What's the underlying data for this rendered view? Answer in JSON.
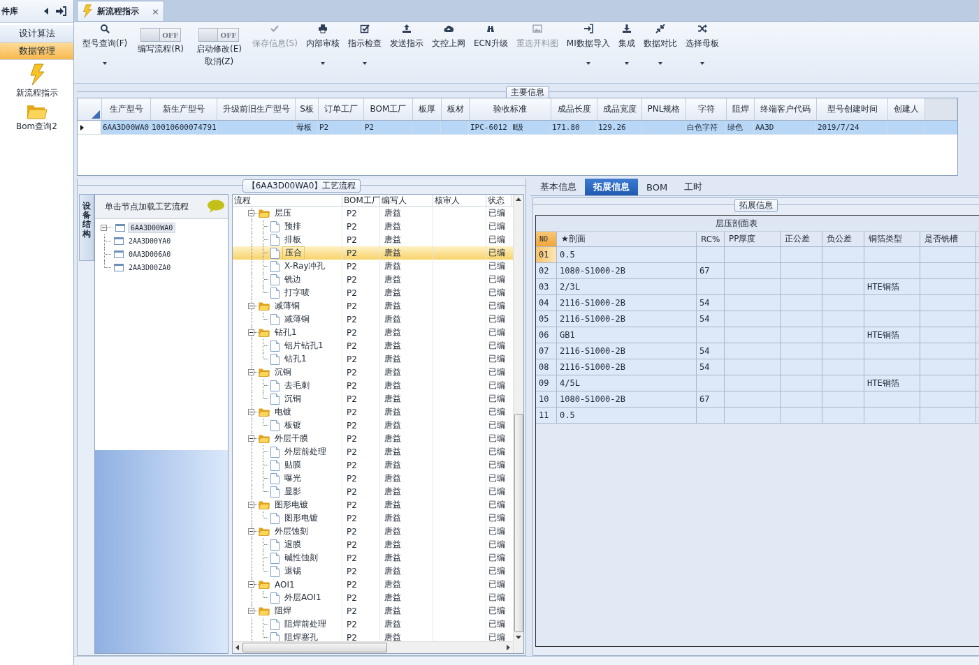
{
  "sidebar": {
    "title": "件库",
    "menu": [
      {
        "label": "设计算法",
        "selected": false
      },
      {
        "label": "数据管理",
        "selected": true
      }
    ],
    "launchers": [
      {
        "label": "新流程指示"
      },
      {
        "label": "Bom查询2"
      }
    ]
  },
  "document_tab": {
    "label": "新流程指示",
    "close": "×"
  },
  "toolbar": [
    {
      "kind": "button",
      "label": "型号查询(F)",
      "dropdown": true,
      "disabled": false
    },
    {
      "kind": "toggle",
      "label": "编写流程(R)",
      "state": "OFF",
      "on": false
    },
    {
      "kind": "toggle",
      "label": "启动修改(E)",
      "sublabel": "取消(Z)",
      "state": "OFF",
      "on": false
    },
    {
      "kind": "button",
      "label": "保存信息(S)",
      "dropdown": false,
      "disabled": true
    },
    {
      "kind": "button",
      "label": "内部审核",
      "dropdown": true,
      "disabled": false
    },
    {
      "kind": "button",
      "label": "指示检查",
      "dropdown": true,
      "disabled": false
    },
    {
      "kind": "button",
      "label": "发送指示",
      "dropdown": false,
      "disabled": false
    },
    {
      "kind": "button",
      "label": "文控上网",
      "dropdown": false,
      "disabled": false
    },
    {
      "kind": "button",
      "label": "ECN升级",
      "dropdown": false,
      "disabled": false
    },
    {
      "kind": "button",
      "label": "重选开料图",
      "dropdown": false,
      "disabled": true
    },
    {
      "kind": "button",
      "label": "MI数据导入",
      "dropdown": true,
      "disabled": false
    },
    {
      "kind": "button",
      "label": "集成",
      "dropdown": true,
      "disabled": false
    },
    {
      "kind": "button",
      "label": "数据对比",
      "dropdown": true,
      "disabled": false
    },
    {
      "kind": "button",
      "label": "选择母板",
      "dropdown": true,
      "disabled": false
    }
  ],
  "main_info": {
    "legend": "主要信息",
    "columns": [
      "生产型号",
      "新生产型号",
      "升级前旧生产型号",
      "S板",
      "订单工厂",
      "BOM工厂",
      "板厚",
      "板材",
      "验收标准",
      "成品长度",
      "成品宽度",
      "PNL规格",
      "字符",
      "阻焊",
      "终端客户代码",
      "型号创建时间",
      "创建人"
    ],
    "rows": [
      {
        "selected": true,
        "cells": [
          "6AA3D00WA0",
          "10010600074791",
          null,
          "母板",
          "P2",
          "P2",
          null,
          null,
          "IPC-6012 Ⅱ级",
          "171.80",
          "129.26",
          null,
          "白色字符",
          "绿色",
          "AA3D",
          "2019/7/24",
          null
        ]
      }
    ]
  },
  "process": {
    "legend": "【6AA3D00WA0】工艺流程",
    "side_tab": "设备结构",
    "hint": "单击节点加载工艺流程",
    "tree": {
      "label": "6AA3D00WA0",
      "expanded": true,
      "selected": true,
      "children": [
        {
          "label": "2AA3D00YA0",
          "selected": false
        },
        {
          "label": "0AA3D006A0",
          "selected": false
        },
        {
          "label": "2AA3D00ZA0",
          "selected": false
        }
      ]
    },
    "columns": [
      "流程",
      "BOM工厂",
      "编写人",
      "核审人",
      "状态"
    ],
    "steps": [
      {
        "name": "层压",
        "bom": "P2",
        "author": "唐益",
        "status": "已编",
        "expanded": true,
        "selected": false,
        "children": [
          {
            "name": "预排",
            "bom": "P2",
            "author": "唐益",
            "status": "已编",
            "selected": false
          },
          {
            "name": "排板",
            "bom": "P2",
            "author": "唐益",
            "status": "已编",
            "selected": false
          },
          {
            "name": "压合",
            "bom": "P2",
            "author": "唐益",
            "status": "已编",
            "selected": true
          },
          {
            "name": "X-Ray冲孔",
            "bom": "P2",
            "author": "唐益",
            "status": "已编",
            "selected": false
          },
          {
            "name": "铣边",
            "bom": "P2",
            "author": "唐益",
            "status": "已编",
            "selected": false
          },
          {
            "name": "打字唛",
            "bom": "P2",
            "author": "唐益",
            "status": "已编",
            "selected": false
          }
        ]
      },
      {
        "name": "减薄铜",
        "bom": "P2",
        "author": "唐益",
        "status": "已编",
        "expanded": true,
        "selected": false,
        "children": [
          {
            "name": "减薄铜",
            "bom": "P2",
            "author": "唐益",
            "status": "已编",
            "selected": false
          }
        ]
      },
      {
        "name": "钻孔1",
        "bom": "P2",
        "author": "唐益",
        "status": "已编",
        "expanded": true,
        "selected": false,
        "children": [
          {
            "name": "铝片钻孔1",
            "bom": "P2",
            "author": "唐益",
            "status": "已编",
            "selected": false
          },
          {
            "name": "钻孔1",
            "bom": "P2",
            "author": "唐益",
            "status": "已编",
            "selected": false
          }
        ]
      },
      {
        "name": "沉铜",
        "bom": "P2",
        "author": "唐益",
        "status": "已编",
        "expanded": true,
        "selected": false,
        "children": [
          {
            "name": "去毛刺",
            "bom": "P2",
            "author": "唐益",
            "status": "已编",
            "selected": false
          },
          {
            "name": "沉铜",
            "bom": "P2",
            "author": "唐益",
            "status": "已编",
            "selected": false
          }
        ]
      },
      {
        "name": "电镀",
        "bom": "P2",
        "author": "唐益",
        "status": "已编",
        "expanded": true,
        "selected": false,
        "children": [
          {
            "name": "板镀",
            "bom": "P2",
            "author": "唐益",
            "status": "已编",
            "selected": false
          }
        ]
      },
      {
        "name": "外层干膜",
        "bom": "P2",
        "author": "唐益",
        "status": "已编",
        "expanded": true,
        "selected": false,
        "children": [
          {
            "name": "外层前处理",
            "bom": "P2",
            "author": "唐益",
            "status": "已编",
            "selected": false
          },
          {
            "name": "贴膜",
            "bom": "P2",
            "author": "唐益",
            "status": "已编",
            "selected": false
          },
          {
            "name": "曝光",
            "bom": "P2",
            "author": "唐益",
            "status": "已编",
            "selected": false
          },
          {
            "name": "显影",
            "bom": "P2",
            "author": "唐益",
            "status": "已编",
            "selected": false
          }
        ]
      },
      {
        "name": "图形电镀",
        "bom": "P2",
        "author": "唐益",
        "status": "已编",
        "expanded": true,
        "selected": false,
        "children": [
          {
            "name": "图形电镀",
            "bom": "P2",
            "author": "唐益",
            "status": "已编",
            "selected": false
          }
        ]
      },
      {
        "name": "外层蚀刻",
        "bom": "P2",
        "author": "唐益",
        "status": "已编",
        "expanded": true,
        "selected": false,
        "children": [
          {
            "name": "退膜",
            "bom": "P2",
            "author": "唐益",
            "status": "已编",
            "selected": false
          },
          {
            "name": "碱性蚀刻",
            "bom": "P2",
            "author": "唐益",
            "status": "已编",
            "selected": false
          },
          {
            "name": "退锡",
            "bom": "P2",
            "author": "唐益",
            "status": "已编",
            "selected": false
          }
        ]
      },
      {
        "name": "AOI1",
        "bom": "P2",
        "author": "唐益",
        "status": "已编",
        "expanded": true,
        "selected": false,
        "children": [
          {
            "name": "外层AOI1",
            "bom": "P2",
            "author": "唐益",
            "status": "已编",
            "selected": false
          }
        ]
      },
      {
        "name": "阻焊",
        "bom": "P2",
        "author": "唐益",
        "status": "已编",
        "expanded": true,
        "selected": false,
        "children": [
          {
            "name": "阻焊前处理",
            "bom": "P2",
            "author": "唐益",
            "status": "已编",
            "selected": false
          },
          {
            "name": "阻焊塞孔",
            "bom": "P2",
            "author": "唐益",
            "status": "已编",
            "selected": false
          }
        ]
      }
    ]
  },
  "detail": {
    "tabs": [
      {
        "label": "基本信息",
        "selected": false
      },
      {
        "label": "拓展信息",
        "selected": true
      },
      {
        "label": "BOM",
        "selected": false
      },
      {
        "label": "工时",
        "selected": false
      }
    ],
    "legend": "拓展信息",
    "table_title": "层压剖面表",
    "columns": [
      "NO",
      "★剖面",
      "RC%",
      "PP厚度",
      "正公差",
      "负公差",
      "铜箔类型",
      "是否铣槽"
    ],
    "rows": [
      {
        "selected": true,
        "cells": [
          "01",
          "0.5",
          null,
          null,
          null,
          null,
          null,
          null
        ]
      },
      {
        "selected": false,
        "cells": [
          "02",
          "1080-S1000-2B",
          "67",
          null,
          null,
          null,
          null,
          null
        ]
      },
      {
        "selected": false,
        "cells": [
          "03",
          "2/3L",
          null,
          null,
          null,
          null,
          "HTE铜箔",
          null
        ]
      },
      {
        "selected": false,
        "cells": [
          "04",
          "2116-S1000-2B",
          "54",
          null,
          null,
          null,
          null,
          null
        ]
      },
      {
        "selected": false,
        "cells": [
          "05",
          "2116-S1000-2B",
          "54",
          null,
          null,
          null,
          null,
          null
        ]
      },
      {
        "selected": false,
        "cells": [
          "06",
          "GB1",
          null,
          null,
          null,
          null,
          "HTE铜箔",
          null
        ]
      },
      {
        "selected": false,
        "cells": [
          "07",
          "2116-S1000-2B",
          "54",
          null,
          null,
          null,
          null,
          null
        ]
      },
      {
        "selected": false,
        "cells": [
          "08",
          "2116-S1000-2B",
          "54",
          null,
          null,
          null,
          null,
          null
        ]
      },
      {
        "selected": false,
        "cells": [
          "09",
          "4/5L",
          null,
          null,
          null,
          null,
          "HTE铜箔",
          null
        ]
      },
      {
        "selected": false,
        "cells": [
          "10",
          "1080-S1000-2B",
          "67",
          null,
          null,
          null,
          null,
          null
        ]
      },
      {
        "selected": false,
        "cells": [
          "11",
          "0.5",
          null,
          null,
          null,
          null,
          null,
          null
        ]
      }
    ]
  }
}
